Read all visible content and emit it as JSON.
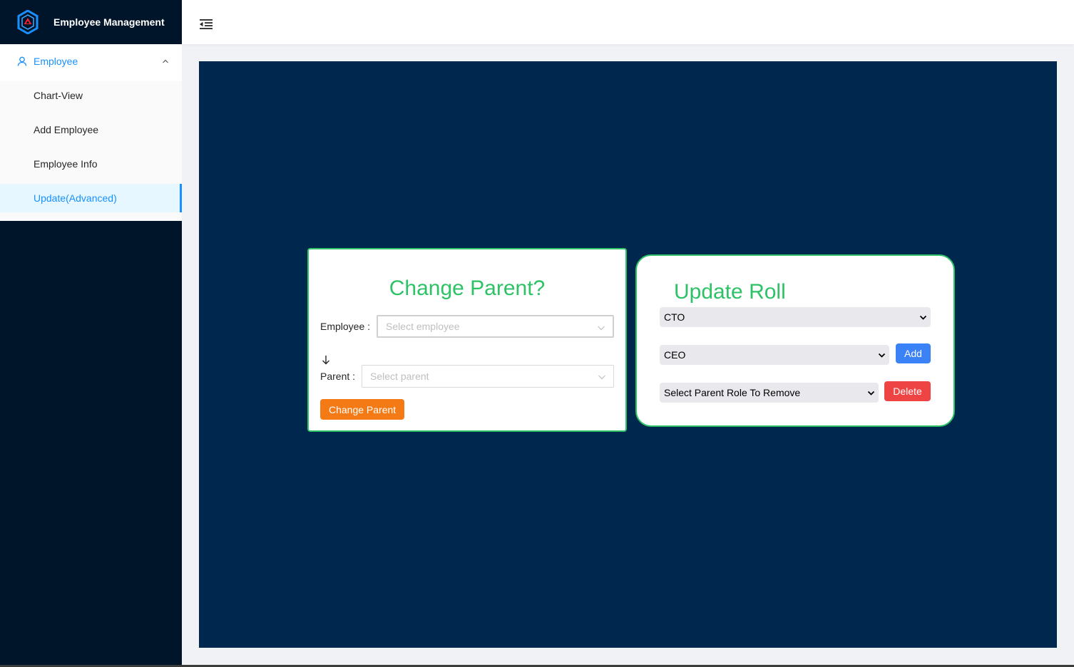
{
  "app": {
    "title": "Employee Management",
    "logo_icon": "hexagon-logo-icon"
  },
  "sidebar": {
    "group": {
      "label": "Employee",
      "icon": "user-icon",
      "expanded": true
    },
    "items": [
      {
        "label": "Chart-View",
        "active": false
      },
      {
        "label": "Add Employee",
        "active": false
      },
      {
        "label": "Employee Info",
        "active": false
      },
      {
        "label": "Update(Advanced)",
        "active": true
      }
    ]
  },
  "header": {
    "menu_fold_icon": "menu-fold-icon"
  },
  "change_parent": {
    "title": "Change Parent?",
    "employee_label": "Employee",
    "employee_placeholder": "Select employee",
    "parent_label": "Parent",
    "parent_placeholder": "Select parent",
    "button_label": "Change Parent"
  },
  "update_roll": {
    "title": "Update Roll",
    "role_select_value": "CTO",
    "parent_select_value": "CEO",
    "add_label": "Add",
    "remove_select_value": "Select Parent Role To Remove",
    "delete_label": "Delete"
  },
  "colors": {
    "sidebar_bg": "#001529",
    "content_bg": "#00284f",
    "accent": "#1890ff",
    "green": "#2ec267",
    "orange": "#f47a16",
    "blue": "#3b82f6",
    "red": "#ef4444"
  }
}
